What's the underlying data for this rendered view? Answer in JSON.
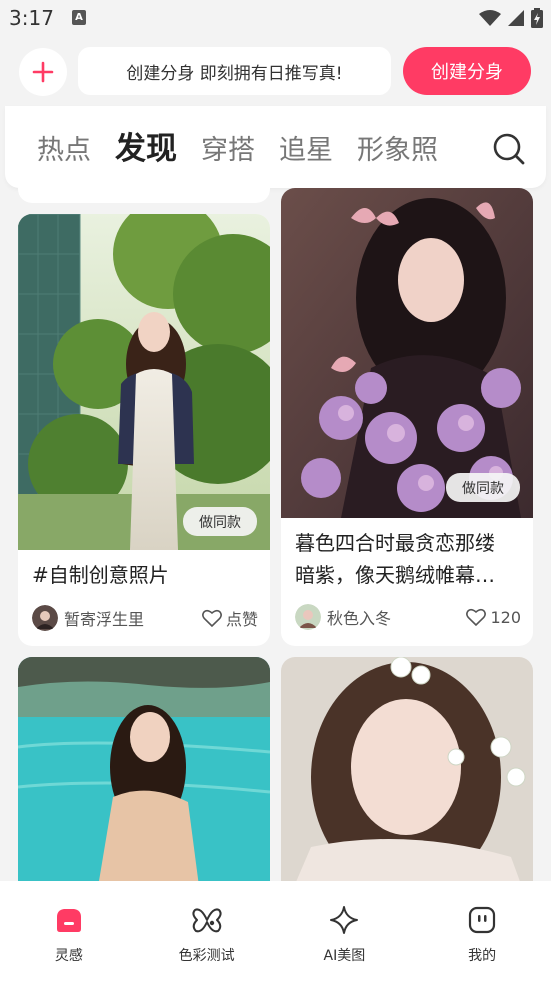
{
  "status_bar": {
    "time": "3:17",
    "notification_glyph": "A"
  },
  "header": {
    "slogan": "创建分身 即刻拥有日推写真!",
    "create_button": "创建分身"
  },
  "tabs": [
    {
      "label": "热点",
      "active": false
    },
    {
      "label": "发现",
      "active": true
    },
    {
      "label": "穿搭",
      "active": false
    },
    {
      "label": "追星",
      "active": false
    },
    {
      "label": "形象照",
      "active": false
    }
  ],
  "feed": {
    "cards": [
      {
        "title": "#自制创意照片",
        "author": "暂寄浮生里",
        "likes": "点赞",
        "same_style": "做同款"
      },
      {
        "title_line1": "暮色四合时最贪恋那缕",
        "title_line2": "暗紫，像天鹅绒帷幕…",
        "author": "秋色入冬",
        "likes": "120",
        "same_style": "做同款"
      }
    ]
  },
  "bottom_nav": [
    {
      "label": "灵感",
      "icon": "inspiration-icon",
      "active": true
    },
    {
      "label": "色彩测试",
      "icon": "butterfly-icon",
      "active": false
    },
    {
      "label": "AI美图",
      "icon": "sparkle-icon",
      "active": false
    },
    {
      "label": "我的",
      "icon": "profile-icon",
      "active": false
    }
  ],
  "colors": {
    "accent": "#ff3b64",
    "background": "#f3f3f3"
  }
}
